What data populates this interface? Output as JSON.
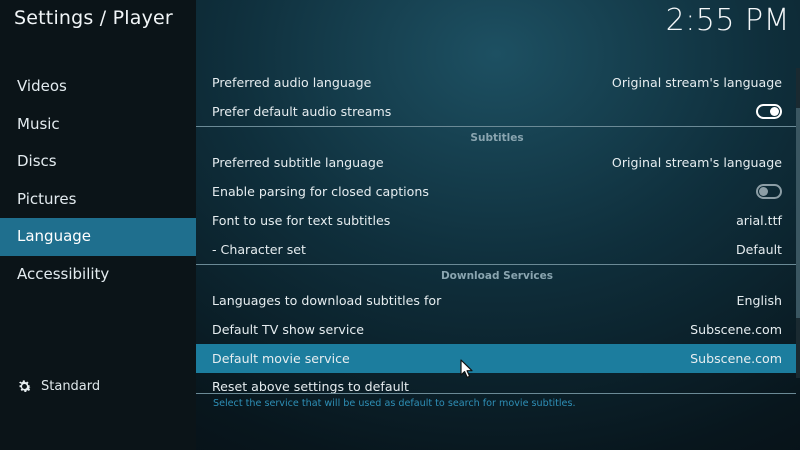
{
  "header": {
    "title": "Settings / Player"
  },
  "clock": "2:55 PM",
  "sidebar": {
    "items": [
      {
        "label": "Videos"
      },
      {
        "label": "Music"
      },
      {
        "label": "Discs"
      },
      {
        "label": "Pictures"
      },
      {
        "label": "Language"
      },
      {
        "label": "Accessibility"
      }
    ],
    "active_index": 4,
    "level_label": "Standard",
    "level_icon": "gear-icon"
  },
  "settings": {
    "audio": [
      {
        "label": "Preferred audio language",
        "value": "Original stream's language"
      },
      {
        "label": "Prefer default audio streams",
        "toggle": "on"
      }
    ],
    "subtitles_header": "Subtitles",
    "subtitles": [
      {
        "label": "Preferred subtitle language",
        "value": "Original stream's language"
      },
      {
        "label": "Enable parsing for closed captions",
        "toggle": "off"
      },
      {
        "label": "Font to use for text subtitles",
        "value": "arial.ttf"
      },
      {
        "label": "- Character set",
        "value": "Default"
      }
    ],
    "download_header": "Download Services",
    "download": [
      {
        "label": "Languages to download subtitles for",
        "value": "English"
      },
      {
        "label": "Default TV show service",
        "value": "Subscene.com"
      },
      {
        "label": "Default movie service",
        "value": "Subscene.com"
      },
      {
        "label": "Reset above settings to default",
        "value": ""
      }
    ]
  },
  "description": "Select the service that will be used as default to search for movie subtitles.",
  "colors": {
    "accent": "#1f6f8e",
    "selected_row": "#1c7d9e",
    "description_text": "#2e8fb6"
  }
}
